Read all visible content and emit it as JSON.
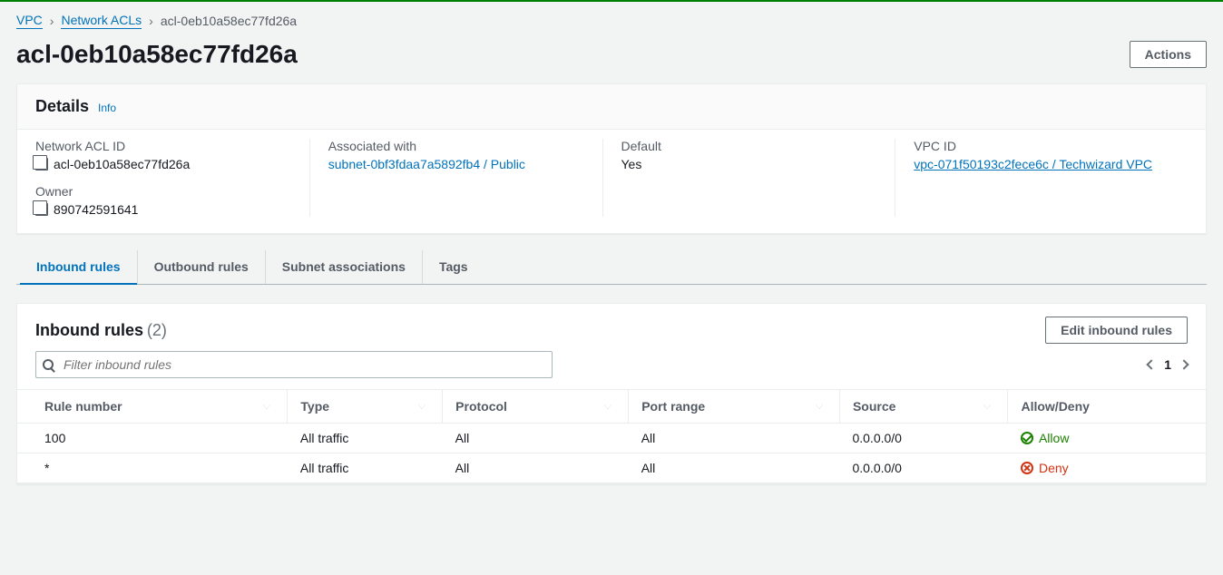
{
  "breadcrumb": {
    "vpc": "VPC",
    "nacls": "Network ACLs",
    "current": "acl-0eb10a58ec77fd26a"
  },
  "page_title": "acl-0eb10a58ec77fd26a",
  "actions_button": "Actions",
  "details": {
    "title": "Details",
    "info_label": "Info",
    "fields": {
      "nacl_id_label": "Network ACL ID",
      "nacl_id_value": "acl-0eb10a58ec77fd26a",
      "owner_label": "Owner",
      "owner_value": "890742591641",
      "associated_label": "Associated with",
      "associated_value": "subnet-0bf3fdaa7a5892fb4 / Public",
      "default_label": "Default",
      "default_value": "Yes",
      "vpc_id_label": "VPC ID",
      "vpc_id_value": "vpc-071f50193c2fece6c / Techwizard VPC"
    }
  },
  "tabs": {
    "inbound": "Inbound rules",
    "outbound": "Outbound rules",
    "subnet_assoc": "Subnet associations",
    "tags": "Tags"
  },
  "inbound": {
    "title": "Inbound rules",
    "count_display": "(2)",
    "edit_button": "Edit inbound rules",
    "filter_placeholder": "Filter inbound rules",
    "page_number": "1",
    "columns": {
      "rule_number": "Rule number",
      "type": "Type",
      "protocol": "Protocol",
      "port_range": "Port range",
      "source": "Source",
      "allow_deny": "Allow/Deny"
    },
    "rows": [
      {
        "rule_number": "100",
        "type": "All traffic",
        "protocol": "All",
        "port_range": "All",
        "source": "0.0.0.0/0",
        "allow_deny": "Allow"
      },
      {
        "rule_number": "*",
        "type": "All traffic",
        "protocol": "All",
        "port_range": "All",
        "source": "0.0.0.0/0",
        "allow_deny": "Deny"
      }
    ]
  }
}
